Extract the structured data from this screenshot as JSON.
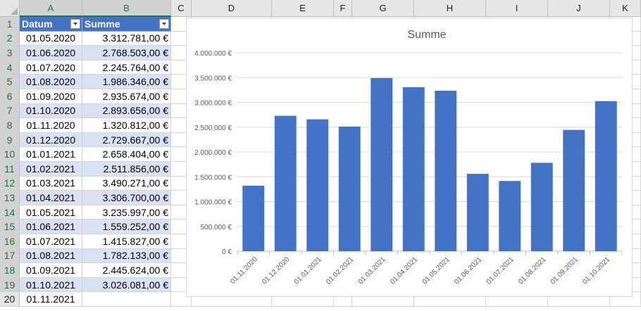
{
  "columns": [
    "A",
    "B",
    "C",
    "D",
    "E",
    "F",
    "G",
    "H",
    "I",
    "J",
    "K"
  ],
  "rows": [
    "1",
    "2",
    "3",
    "4",
    "5",
    "6",
    "7",
    "8",
    "9",
    "10",
    "11",
    "12",
    "13",
    "14",
    "15",
    "16",
    "17",
    "18",
    "19",
    "20"
  ],
  "table": {
    "headers": [
      "Datum",
      "Summe"
    ],
    "rows": [
      [
        "01.05.2020",
        "3.312.781,00 €"
      ],
      [
        "01.06.2020",
        "2.768.503,00 €"
      ],
      [
        "01.07.2020",
        "2.245.764,00 €"
      ],
      [
        "01.08.2020",
        "1.986.346,00 €"
      ],
      [
        "01.09.2020",
        "2.935.674,00 €"
      ],
      [
        "01.10.2020",
        "2.893.656,00 €"
      ],
      [
        "01.11.2020",
        "1.320.812,00 €"
      ],
      [
        "01.12.2020",
        "2.729.667,00 €"
      ],
      [
        "01.01.2021",
        "2.658.404,00 €"
      ],
      [
        "01.02.2021",
        "2.511.856,00 €"
      ],
      [
        "01.03.2021",
        "3.490.271,00 €"
      ],
      [
        "01.04.2021",
        "3.306.700,00 €"
      ],
      [
        "01.05.2021",
        "3.235.997,00 €"
      ],
      [
        "01.06.2021",
        "1.559.252,00 €"
      ],
      [
        "01.07.2021",
        "1.415.827,00 €"
      ],
      [
        "01.08.2021",
        "1.782.133,00 €"
      ],
      [
        "01.09.2021",
        "2.445.624,00 €"
      ],
      [
        "01.10.2021",
        "3.026.081,00 €"
      ],
      [
        "01.11.2021",
        ""
      ]
    ]
  },
  "chart_data": {
    "type": "bar",
    "title": "Summe",
    "categories": [
      "01.11.2020",
      "01.12.2020",
      "01.01.2021",
      "01.02.2021",
      "01.03.2021",
      "01.04.2021",
      "01.05.2021",
      "01.06.2021",
      "01.07.2021",
      "01.08.2021",
      "01.09.2021",
      "01.10.2021"
    ],
    "values": [
      1320812,
      2729667,
      2658404,
      2511856,
      3490271,
      3306700,
      3235997,
      1559252,
      1415827,
      1782133,
      2445624,
      3026081
    ],
    "ylim": [
      0,
      4000000
    ],
    "yticks": [
      0,
      500000,
      1000000,
      1500000,
      2000000,
      2500000,
      3000000,
      3500000,
      4000000
    ],
    "ytick_labels": [
      "0 €",
      "500.000 €",
      "1.000.000 €",
      "1.500.000 €",
      "2.000.000 €",
      "2.500.000 €",
      "3.000.000 €",
      "3.500.000 €",
      "4.000.000 €"
    ],
    "bar_color": "#4472c4",
    "gridlines": true,
    "legend": "none"
  },
  "colors": {
    "header_fill": "#4472c4",
    "band_fill": "#d9e1f2",
    "select_accent": "#217346"
  }
}
